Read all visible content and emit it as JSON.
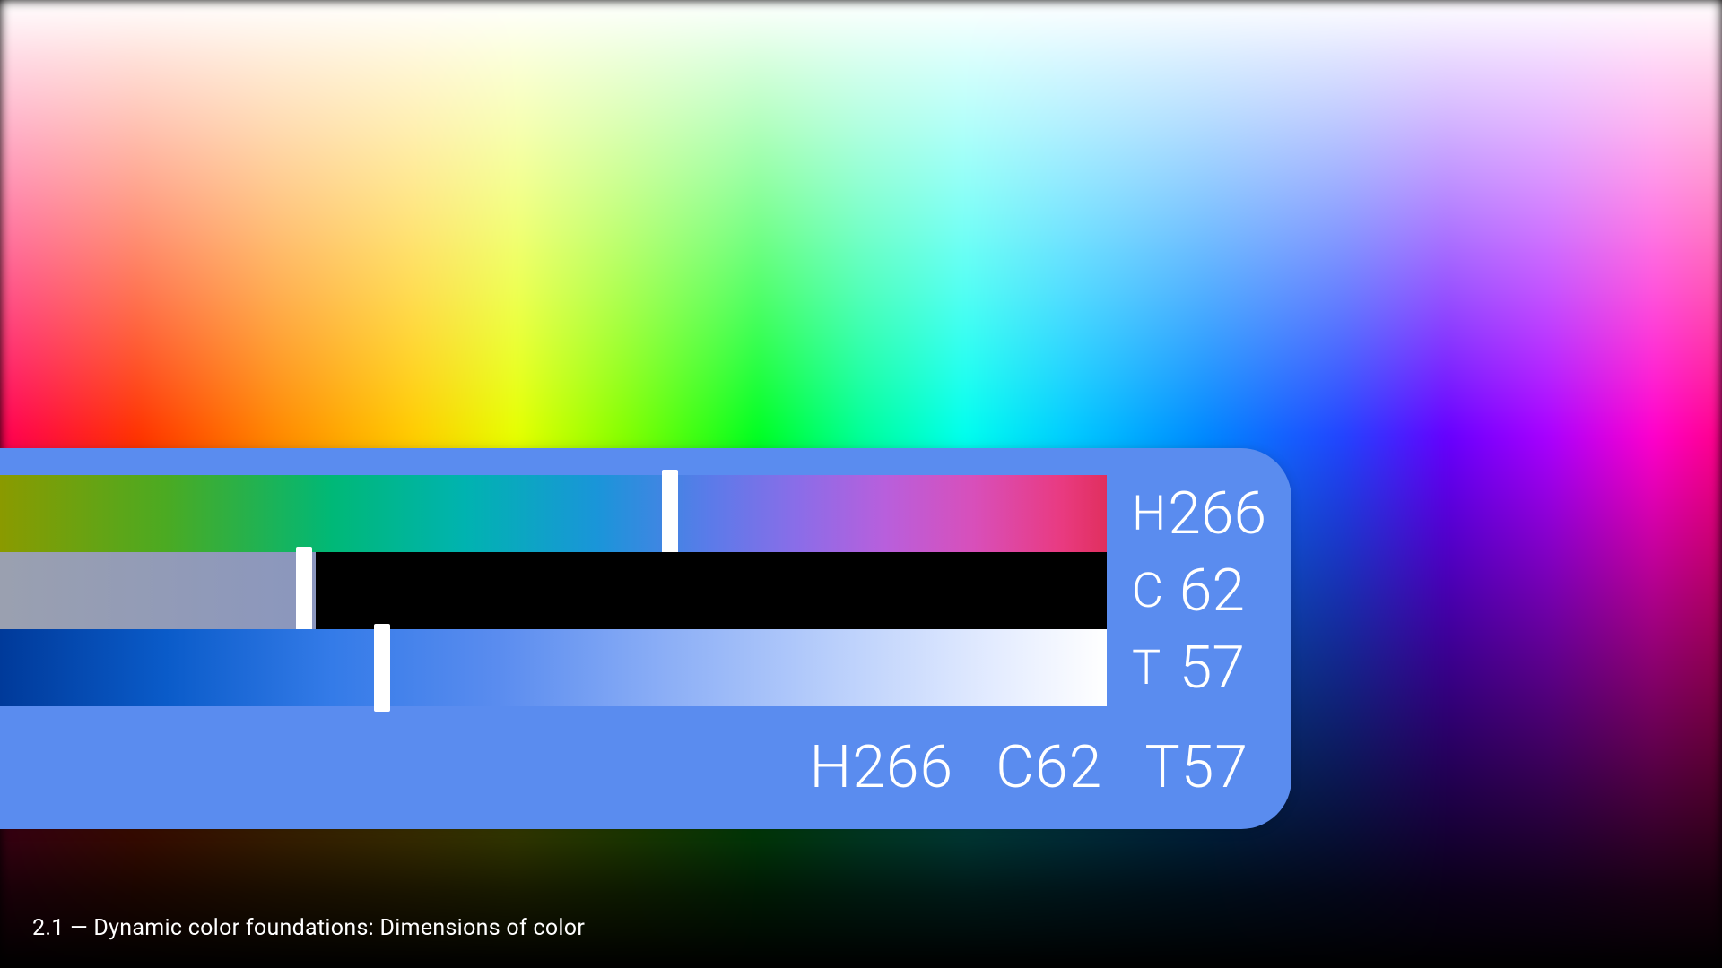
{
  "caption": "2.1 — Dynamic color foundations: Dimensions of color",
  "panel": {
    "accent": "#5a8cef",
    "sliders": {
      "hue": {
        "label": "H",
        "value": 266,
        "max": 360,
        "thumb_pct": 60.5
      },
      "chroma": {
        "label": "C",
        "value": 62,
        "max": 150,
        "thumb_pct": 27.5,
        "void_start_pct": 28.5
      },
      "tone": {
        "label": "T",
        "value": 57,
        "max": 100,
        "thumb_pct": 34.5
      }
    },
    "summary": {
      "h": "H266",
      "c": "C62",
      "t": "T57"
    }
  }
}
